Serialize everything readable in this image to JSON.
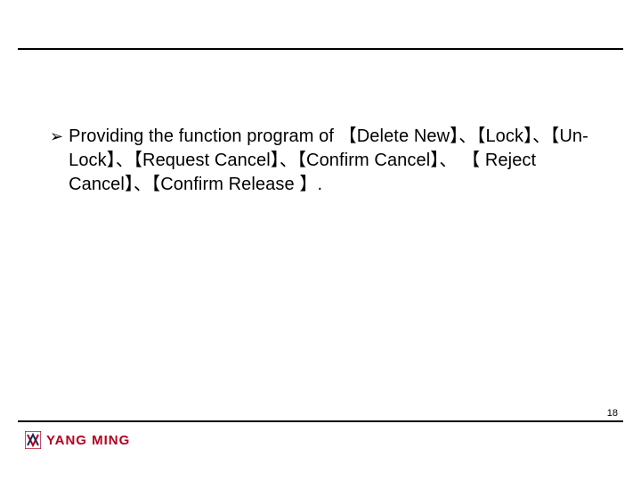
{
  "body": {
    "bullet_text": "Providing the function program of 【Delete New】、【Lock】、【Un-Lock】、【Request Cancel】、【Confirm Cancel】、 【 Reject Cancel】、【Confirm Release 】."
  },
  "footer": {
    "brand": "YANG MING",
    "page_number": "18"
  }
}
